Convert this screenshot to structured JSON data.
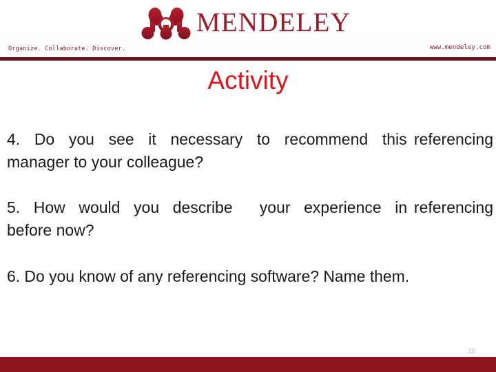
{
  "header": {
    "brand_name": "MENDELEY",
    "logo_icon": "mendeley-molecule-logo",
    "tagline": "Organize. Collaborate. Discover.",
    "site_url": "www.mendeley.com"
  },
  "title": "Activity",
  "questions": [
    {
      "id": "question-4",
      "text": "4.  Do  you  see  it  necessary  to  recommend  this referencing manager to your colleague?"
    },
    {
      "id": "question-5",
      "text": "5.  How  would  you  describe    your  experience  in referencing before now?"
    },
    {
      "id": "question-6",
      "text": "6. Do you know of any referencing software? Name them."
    }
  ],
  "footer": {
    "page_number": "30"
  },
  "colors": {
    "brand_red": "#9e1b28",
    "title_red": "#d9151c",
    "rule_top": "#6b1520",
    "rule_bottom": "#8c1520",
    "tagline_text": "#7d1d26",
    "body_text": "#1a1a1a",
    "page_number": "#b9b9b9"
  }
}
